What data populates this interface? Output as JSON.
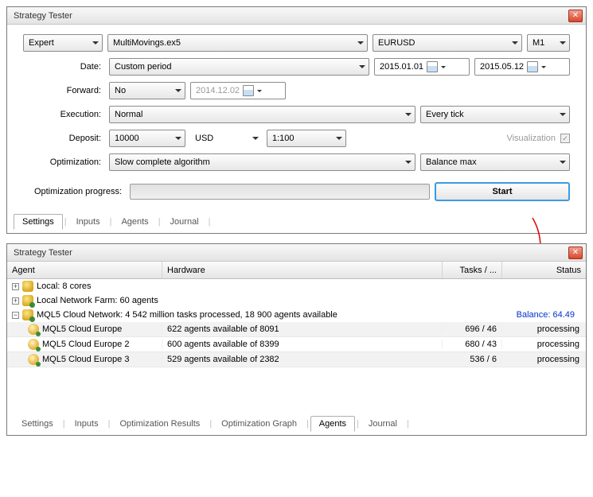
{
  "top": {
    "title": "Strategy Tester",
    "expert_mode": "Expert",
    "expert_file": "MultiMovings.ex5",
    "symbol": "EURUSD",
    "period": "M1",
    "labels": {
      "date": "Date:",
      "forward": "Forward:",
      "execution": "Execution:",
      "deposit": "Deposit:",
      "optimization": "Optimization:",
      "opt_progress": "Optimization progress:",
      "visualization": "Visualization"
    },
    "date_mode": "Custom period",
    "date_from": "2015.01.01",
    "date_to": "2015.05.12",
    "forward": "No",
    "forward_date": "2014.12.02",
    "execution": "Normal",
    "model": "Every tick",
    "deposit_amount": "10000",
    "deposit_currency": "USD",
    "leverage": "1:100",
    "optimization_algo": "Slow complete algorithm",
    "optimization_criterion": "Balance max",
    "start_btn": "Start",
    "tabs": [
      "Settings",
      "Inputs",
      "Agents",
      "Journal"
    ],
    "active_tab": "Settings"
  },
  "bottom": {
    "title": "Strategy Tester",
    "columns": {
      "agent": "Agent",
      "hardware": "Hardware",
      "tasks": "Tasks / ...",
      "status": "Status"
    },
    "nodes": {
      "local": "Local: 8 cores",
      "farm": "Local Network Farm: 60 agents",
      "cloud": "MQL5 Cloud Network: 4 542 million tasks processed, 18 900 agents available",
      "balance_label": "Balance: 64.49"
    },
    "agents": [
      {
        "name": "MQL5 Cloud Europe",
        "hw": "622 agents available of 8091",
        "tasks": "696 / 46",
        "status": "processing"
      },
      {
        "name": "MQL5 Cloud Europe 2",
        "hw": "600 agents available of 8399",
        "tasks": "680 / 43",
        "status": "processing"
      },
      {
        "name": "MQL5 Cloud Europe 3",
        "hw": "529 agents available of 2382",
        "tasks": "536 / 6",
        "status": "processing"
      }
    ],
    "tabs": [
      "Settings",
      "Inputs",
      "Optimization Results",
      "Optimization Graph",
      "Agents",
      "Journal"
    ],
    "active_tab": "Agents"
  }
}
